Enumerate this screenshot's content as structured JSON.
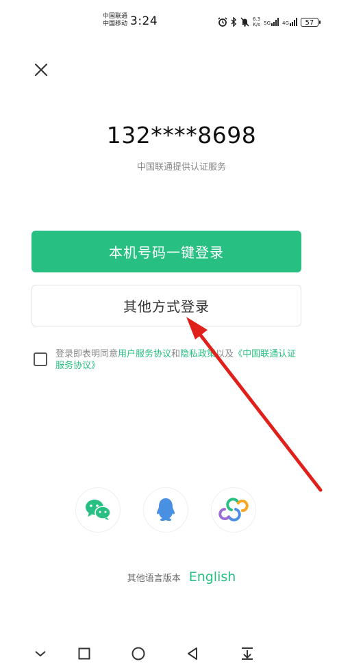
{
  "status_bar": {
    "carrier_1": "中国联通",
    "carrier_2": "中国移动",
    "time": "3:24",
    "net_speed_top": "6.3",
    "net_speed_bottom": "K/s",
    "net_1": "5G",
    "net_2": "4G",
    "battery": "57"
  },
  "header": {
    "close_icon": "close-icon"
  },
  "phone_number": "132****8698",
  "provider_text": "中国联通提供认证服务",
  "buttons": {
    "one_click_login": "本机号码一键登录",
    "other_login": "其他方式登录"
  },
  "agreement": {
    "prefix": "登录即表明同意",
    "user_agreement": "用户服务协议",
    "and": "和",
    "privacy_policy": "隐私政策",
    "and_also": "以及",
    "carrier_agreement": "《中国联通认证服务协议》"
  },
  "social_logins": [
    {
      "icon": "wechat-icon"
    },
    {
      "icon": "qq-icon"
    },
    {
      "icon": "app-logo-icon"
    }
  ],
  "language": {
    "label": "其他语言版本",
    "english": "English"
  },
  "colors": {
    "accent": "#27c082",
    "annotation_arrow": "#e0201b"
  },
  "nav_bar": [
    "chevron-down-icon",
    "square-icon",
    "circle-icon",
    "triangle-back-icon",
    "download-icon"
  ]
}
